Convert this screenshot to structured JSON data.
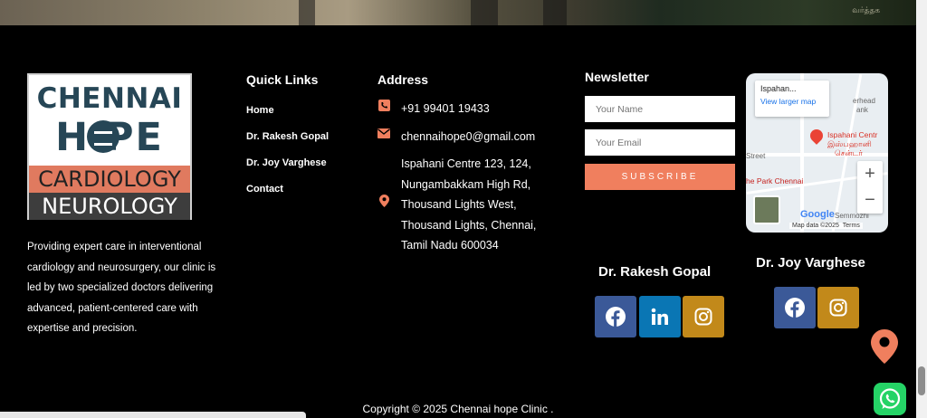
{
  "logo": {
    "line1": "CHENNAI",
    "line2": "H PE",
    "line3": "CARDIOLOGY",
    "line4": "NEUROLOGY"
  },
  "about": "Providing expert care in interventional cardiology and neurosurgery, our clinic is led by two specialized doctors delivering advanced, patient-centered care with expertise and precision.",
  "quick_links": {
    "heading": "Quick Links",
    "items": [
      "Home",
      "Dr. Rakesh Gopal",
      "Dr. Joy Varghese",
      "Contact"
    ]
  },
  "address": {
    "heading": "Address",
    "phone": "+91 99401 19433",
    "email": "chennaihope0@gmail.com",
    "location_lines": [
      "Ispahani Centre 123, 124,",
      "Nungambakkam High Rd,",
      "Thousand Lights West,",
      "Thousand Lights, Chennai,",
      "Tamil Nadu 600034"
    ]
  },
  "newsletter": {
    "heading": "Newsletter",
    "name_placeholder": "Your Name",
    "email_placeholder": "Your Email",
    "subscribe_label": "SUBSCRIBE"
  },
  "map": {
    "place_title": "Ispahan...",
    "larger_map_link": "View larger map",
    "pin_label_1": "Ispahani Centr",
    "pin_label_2": "இஸ்பஹானி",
    "pin_label_3": "சென்டர்",
    "hotel_label": "he Park Chennai",
    "street_label": "Street",
    "area_label": "Semmozhi",
    "google": "Google",
    "map_data": "Map data ©2025",
    "terms": "Terms",
    "zoom_in": "+",
    "zoom_out": "−",
    "overhead": "erhead",
    "bank": "ank"
  },
  "doctors": [
    {
      "name": "Dr. Rakesh Gopal"
    },
    {
      "name": "Dr. Joy Varghese"
    }
  ],
  "hero": {
    "tamil_text": "வர்த்தக"
  },
  "copyright": "Copyright © 2025 Chennai hope Clinic .",
  "colors": {
    "accent": "#f07f5e",
    "facebook": "#3b5998",
    "linkedin": "#0a76b4",
    "instagram": "#c2891a",
    "whatsapp": "#25d366"
  }
}
